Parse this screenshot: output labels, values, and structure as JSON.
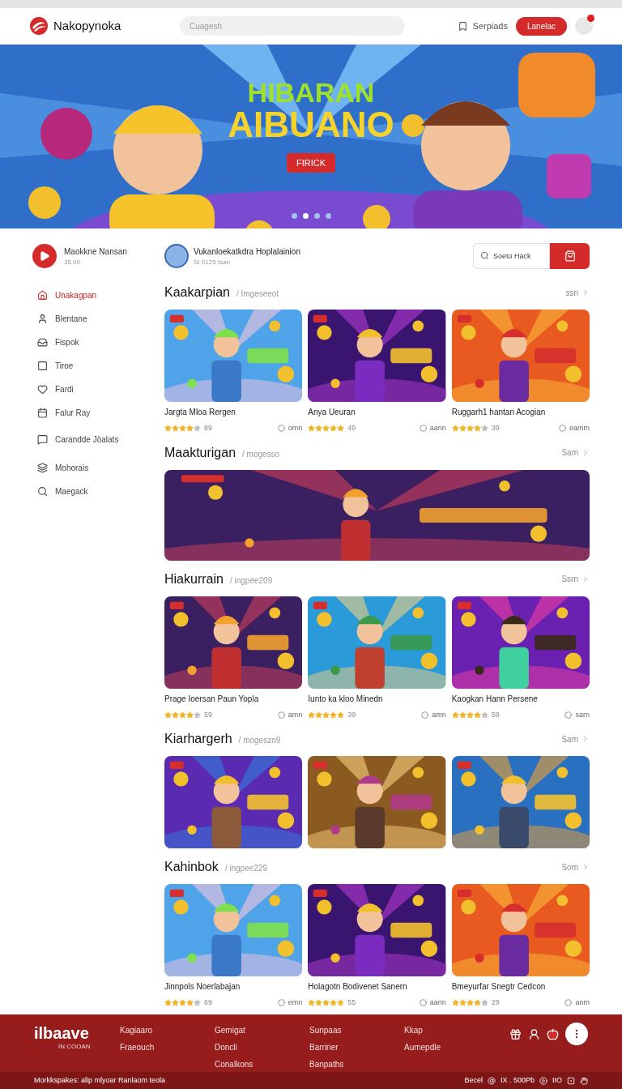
{
  "header": {
    "logo": "Nakopynoka",
    "search": {
      "placeholder": "Cuagesh"
    },
    "saved_link": "Serpiads",
    "action_button": "Lanelac"
  },
  "hero": {
    "title_lines": [
      "HIBARAN",
      "AIBUANO"
    ],
    "button": "FIRICK",
    "dots": [
      {
        "selected": false
      },
      {
        "selected": true
      },
      {
        "selected": false
      },
      {
        "selected": false
      }
    ]
  },
  "sidebar": {
    "channel": {
      "name": "Maokkne Nansan",
      "sub": "35.09"
    },
    "items": [
      {
        "label": "Unakagpan",
        "selected": true
      },
      {
        "label": "Blentane",
        "selected": false
      },
      {
        "label": "Fispok",
        "selected": false
      },
      {
        "label": "Tiroe",
        "selected": false
      },
      {
        "label": "Fardi",
        "selected": false
      },
      {
        "label": "Falur Ray",
        "selected": false
      },
      {
        "label": "Carandde Jöalats",
        "selected": false
      },
      {
        "label": "Mohorais",
        "selected": false
      },
      {
        "label": "Maegack",
        "selected": false
      }
    ]
  },
  "profile": {
    "name": "Vukanloekatkdra Hoplalainion",
    "sub": "SI 0125 Isan",
    "search": {
      "placeholder": "Soeto Hack"
    }
  },
  "sections": [
    {
      "kind": "cards",
      "title": "Kaakarpian",
      "subtitle": "/ Imgeseeol",
      "link": "ssn",
      "cards": [
        {
          "title": "Jargta Mloa Rergen",
          "stars": 4,
          "count": "89",
          "meta": "omn"
        },
        {
          "title": "Anya Ueuran",
          "stars": 5,
          "count": "49",
          "meta": "aann"
        },
        {
          "title": "Ruggarh1 hantan Acogian",
          "stars": 4,
          "count": "39",
          "meta": "eamm"
        }
      ]
    },
    {
      "kind": "banner",
      "title": "Maakturigan",
      "subtitle": "/ mogesso",
      "link": "Sam"
    },
    {
      "kind": "cards",
      "title": "Hiakurrain",
      "subtitle": "/ ingpee209",
      "link": "Ssrn",
      "cards": [
        {
          "title": "Prage Ioersan Paun Yopla",
          "stars": 4,
          "count": "59",
          "meta": "amn"
        },
        {
          "title": "Iunto ka kloo Minedn",
          "stars": 5,
          "count": "39",
          "meta": "amn"
        },
        {
          "title": "Kaogkan Hann Persene",
          "stars": 4,
          "count": "59",
          "meta": "sarn"
        }
      ]
    },
    {
      "kind": "cards",
      "title": "Kiarhargerh",
      "subtitle": "/ mogeszo9",
      "link": "Sam"
    },
    {
      "kind": "cards",
      "title": "Kahinbok",
      "subtitle": "/ ingpee229",
      "link": "Som",
      "cards": [
        {
          "title": "Jinnpols Noerlabajan",
          "stars": 4,
          "count": "69",
          "meta": "emn"
        },
        {
          "title": "Holagotn Bodivenet Sanern",
          "stars": 5,
          "count": "55",
          "meta": "aann"
        },
        {
          "title": "Bmeyurfar Snegtr Cedcon",
          "stars": 4,
          "count": "29",
          "meta": "anm"
        }
      ]
    }
  ],
  "footer": {
    "logo": "ilbaave",
    "logo_sub": "IN COOAN",
    "columns": [
      [
        "Kagiaaro",
        "Fraeouch"
      ],
      [
        "Gemigat",
        "Doncli",
        "Conalkons"
      ],
      [
        "Sunpaas",
        "Barririer",
        "Banpaths"
      ],
      [
        "Kkap",
        "Aumepdle"
      ]
    ],
    "bottom_text": "Morkkspakes: alip mlyoar Ranlaom teola",
    "bottom_right": [
      "Becel",
      "IX . 500Pb",
      "IIO"
    ]
  }
}
